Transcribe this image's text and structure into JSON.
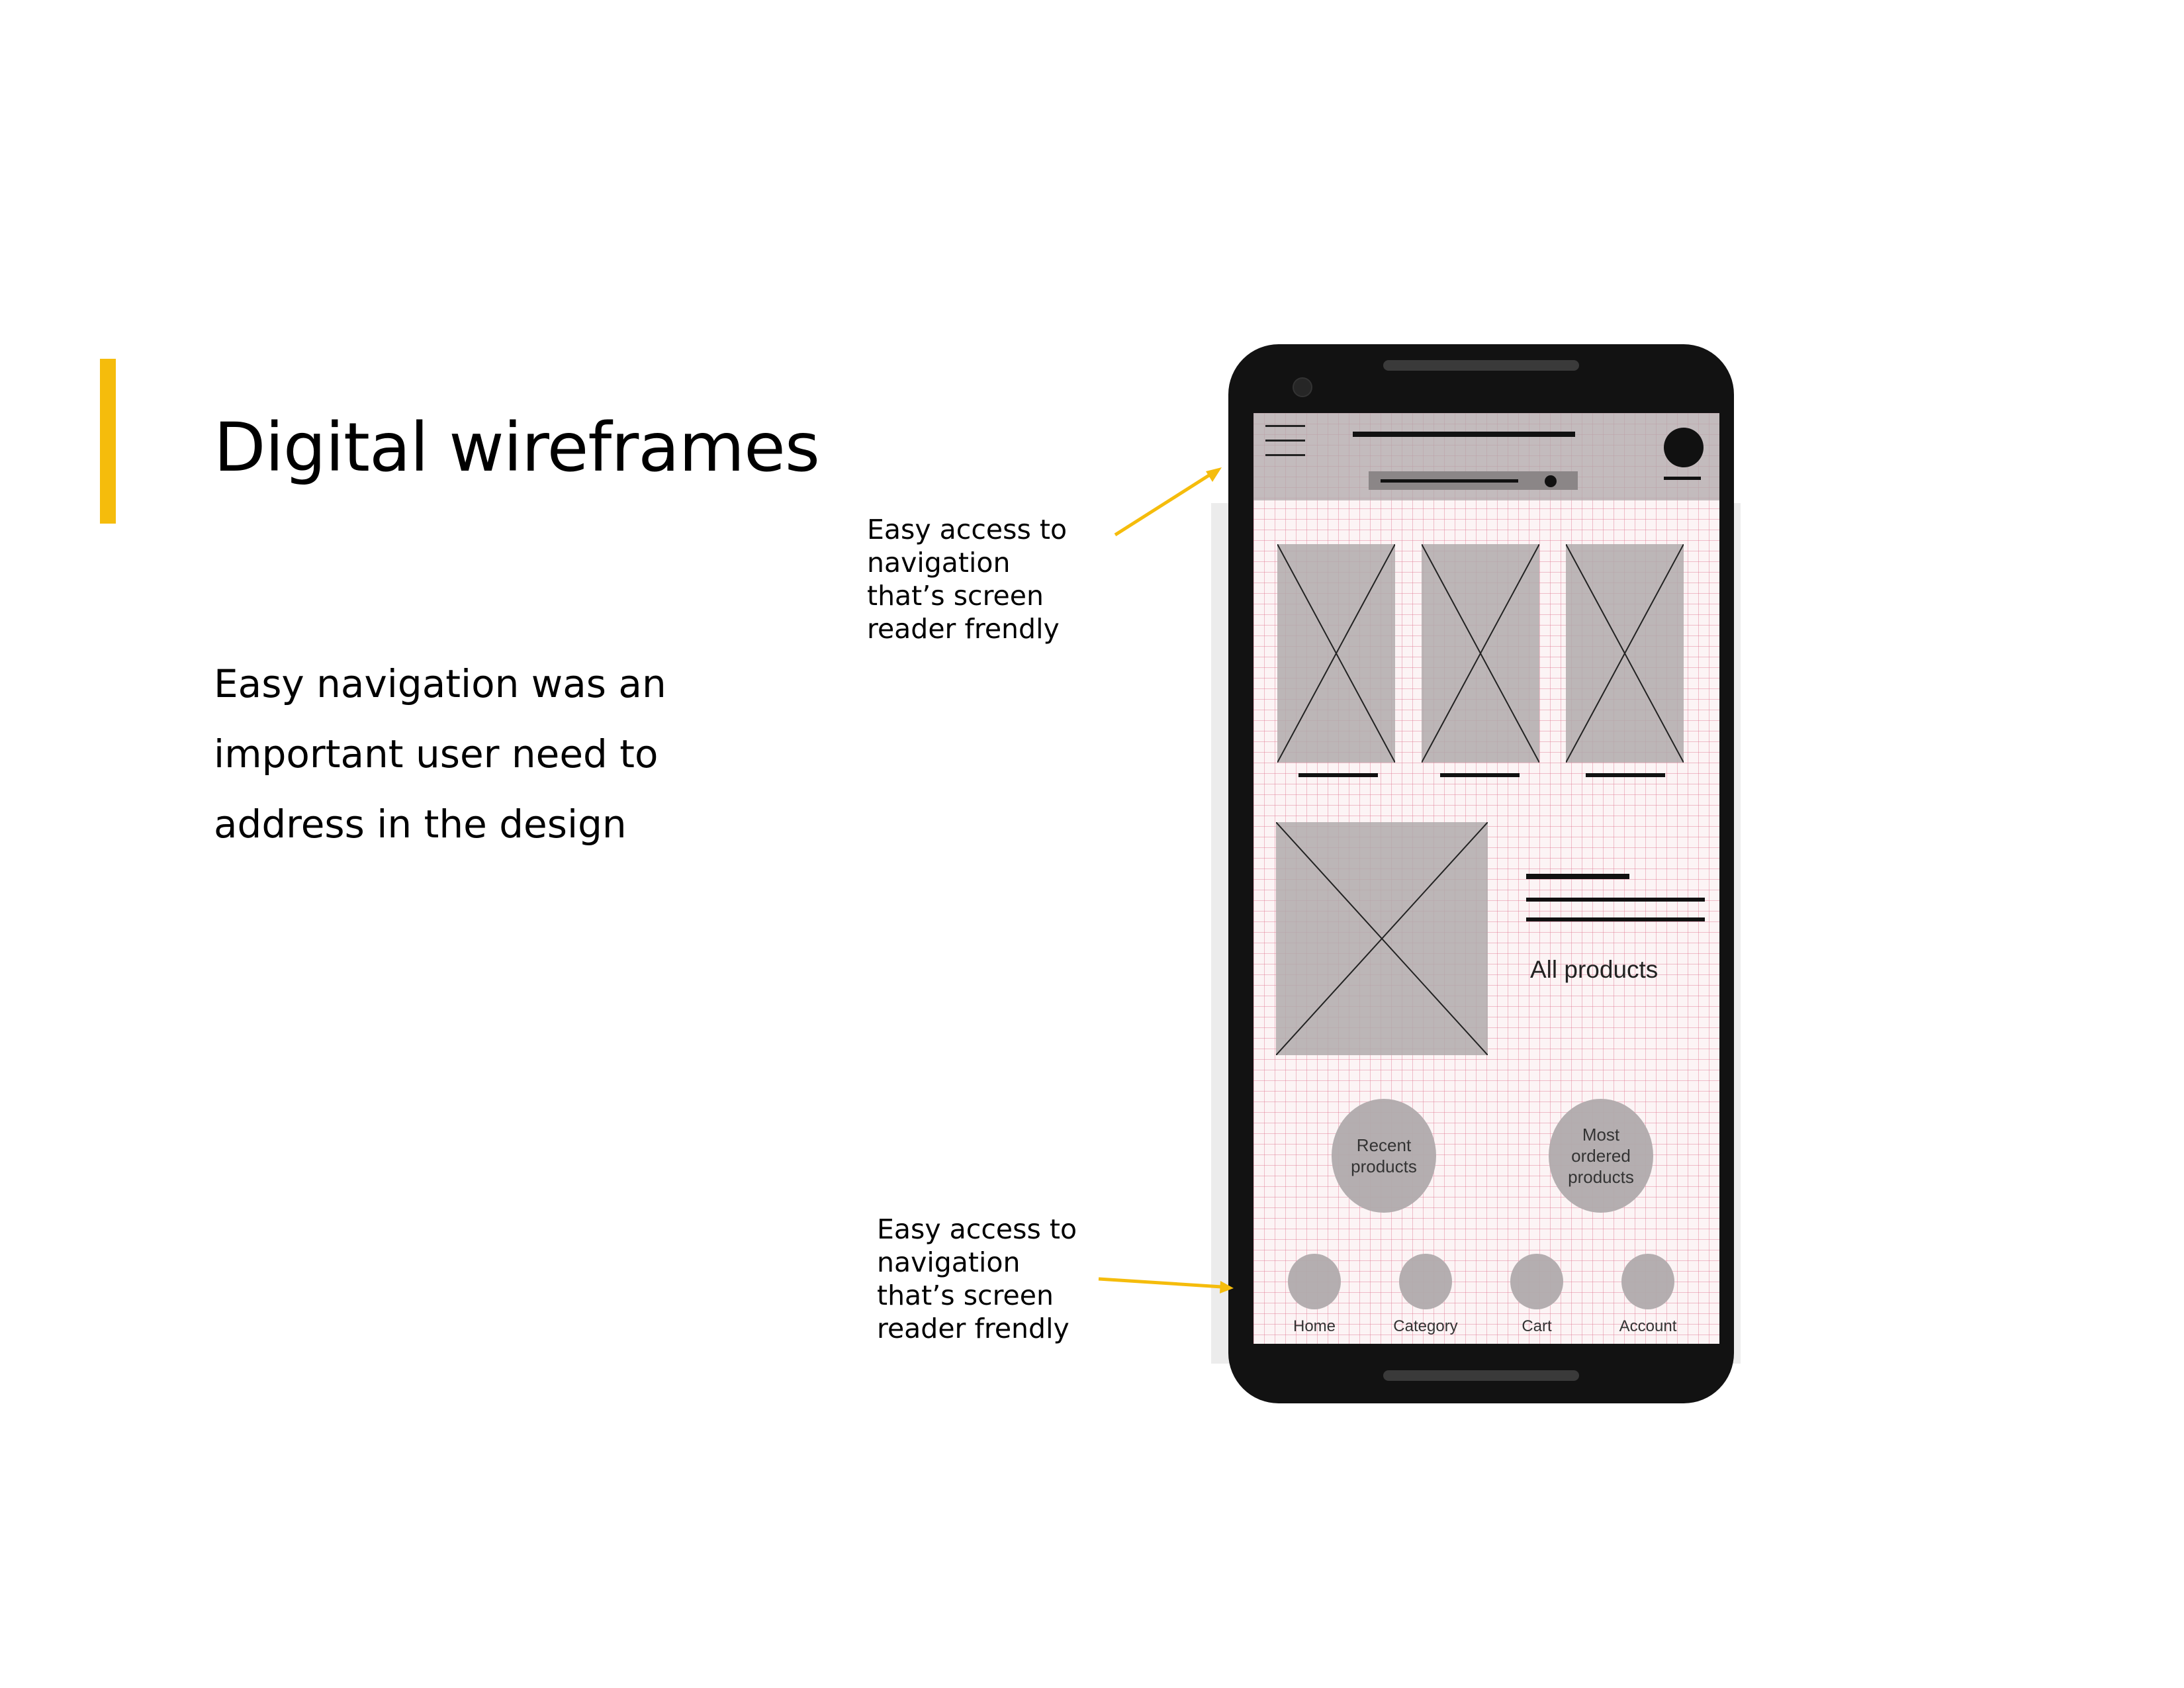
{
  "slide": {
    "title": "Digital wireframes",
    "body_lines": [
      "Easy navigation was an",
      "important user need to",
      "address in the design"
    ],
    "accent_color": "#F5BC0C"
  },
  "callouts": {
    "top": [
      "Easy access to",
      "navigation",
      "that’s screen",
      "reader frendly"
    ],
    "bottom": [
      "Easy access to",
      "navigation",
      "that’s screen",
      "reader frendly"
    ]
  },
  "wireframe": {
    "header": {
      "menu_icon": "hamburger-menu-icon",
      "avatar_icon": "user-avatar-icon",
      "search_icon": "search-dot-icon"
    },
    "placeholder_icon": "image-placeholder-icon",
    "all_products_label": "All products",
    "circle_buttons": {
      "recent": [
        "Recent",
        "products"
      ],
      "most_ordered": [
        "Most",
        "ordered",
        "products"
      ]
    },
    "bottom_nav": [
      {
        "label": "Home"
      },
      {
        "label": "Category"
      },
      {
        "label": "Cart"
      },
      {
        "label": "Account"
      }
    ]
  }
}
